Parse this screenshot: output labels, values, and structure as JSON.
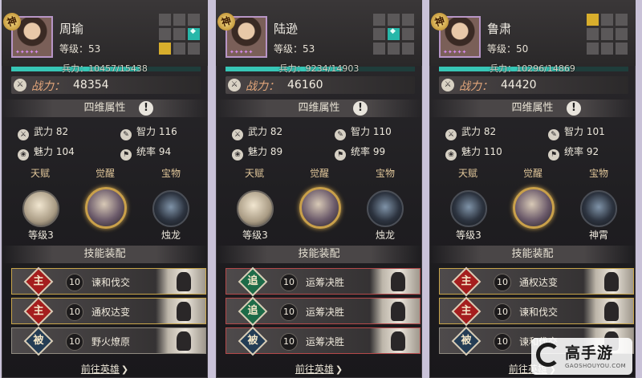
{
  "panels": [
    {
      "name": "周瑜",
      "level": "等级：53",
      "god": "神",
      "troops": "兵力：10457/15438",
      "troops_fraction": 0.677,
      "power_label": "战力：",
      "power_value": "48354",
      "attr_title": "四维属性",
      "attrs": {
        "wuli": "武力 82",
        "zhili": "智力 116",
        "meili": "魅力 104",
        "tongshuai": "统率 94"
      },
      "tabs": {
        "talent": "天赋",
        "awaken": "觉醒",
        "treasure": "宝物"
      },
      "talent_label": "等级3",
      "treasure_label": "烛龙",
      "skill_title": "技能装配",
      "skills": [
        {
          "type": "主",
          "level": "10",
          "name": "谏和伐交"
        },
        {
          "type": "主",
          "level": "10",
          "name": "通权达变"
        },
        {
          "type": "被",
          "level": "10",
          "name": "野火燎原"
        }
      ],
      "goto": "前往英雄"
    },
    {
      "name": "陆逊",
      "level": "等级：53",
      "god": "神",
      "troops": "兵力：9234/14903",
      "troops_fraction": 0.62,
      "power_label": "战力：",
      "power_value": "46160",
      "attr_title": "四维属性",
      "attrs": {
        "wuli": "武力 82",
        "zhili": "智力 110",
        "meili": "魅力 89",
        "tongshuai": "统率 99"
      },
      "tabs": {
        "talent": "天赋",
        "awaken": "觉醒",
        "treasure": "宝物"
      },
      "talent_label": "等级3",
      "treasure_label": "烛龙",
      "skill_title": "技能装配",
      "skills": [
        {
          "type": "追",
          "level": "10",
          "name": "运筹决胜"
        },
        {
          "type": "追",
          "level": "10",
          "name": "运筹决胜"
        },
        {
          "type": "被",
          "level": "10",
          "name": "运筹决胜"
        }
      ],
      "goto": "前往英雄"
    },
    {
      "name": "鲁肃",
      "level": "等级：50",
      "god": "神",
      "troops": "兵力：10296/14869",
      "troops_fraction": 0.692,
      "power_label": "战力：",
      "power_value": "44420",
      "attr_title": "四维属性",
      "attrs": {
        "wuli": "武力 82",
        "zhili": "智力 101",
        "meili": "魅力 110",
        "tongshuai": "统率 92"
      },
      "tabs": {
        "talent": "天赋",
        "awaken": "觉醒",
        "treasure": "宝物"
      },
      "talent_label": "等级3",
      "treasure_label": "神霄",
      "skill_title": "技能装配",
      "skills": [
        {
          "type": "主",
          "level": "10",
          "name": "通权达变"
        },
        {
          "type": "主",
          "level": "10",
          "name": "谏和伐交"
        },
        {
          "type": "被",
          "level": "10",
          "name": "谏和伐交"
        }
      ],
      "goto": "前往英雄"
    }
  ],
  "watermark": {
    "title": "高手游",
    "sub": "GAOSHOUYOU.COM"
  },
  "colors": {
    "teal": "#37c6b6",
    "gold": "#d8ae2c",
    "main_skill": "#a51e1e",
    "chase_skill": "#1d6b48",
    "passive_skill": "#243d55"
  }
}
